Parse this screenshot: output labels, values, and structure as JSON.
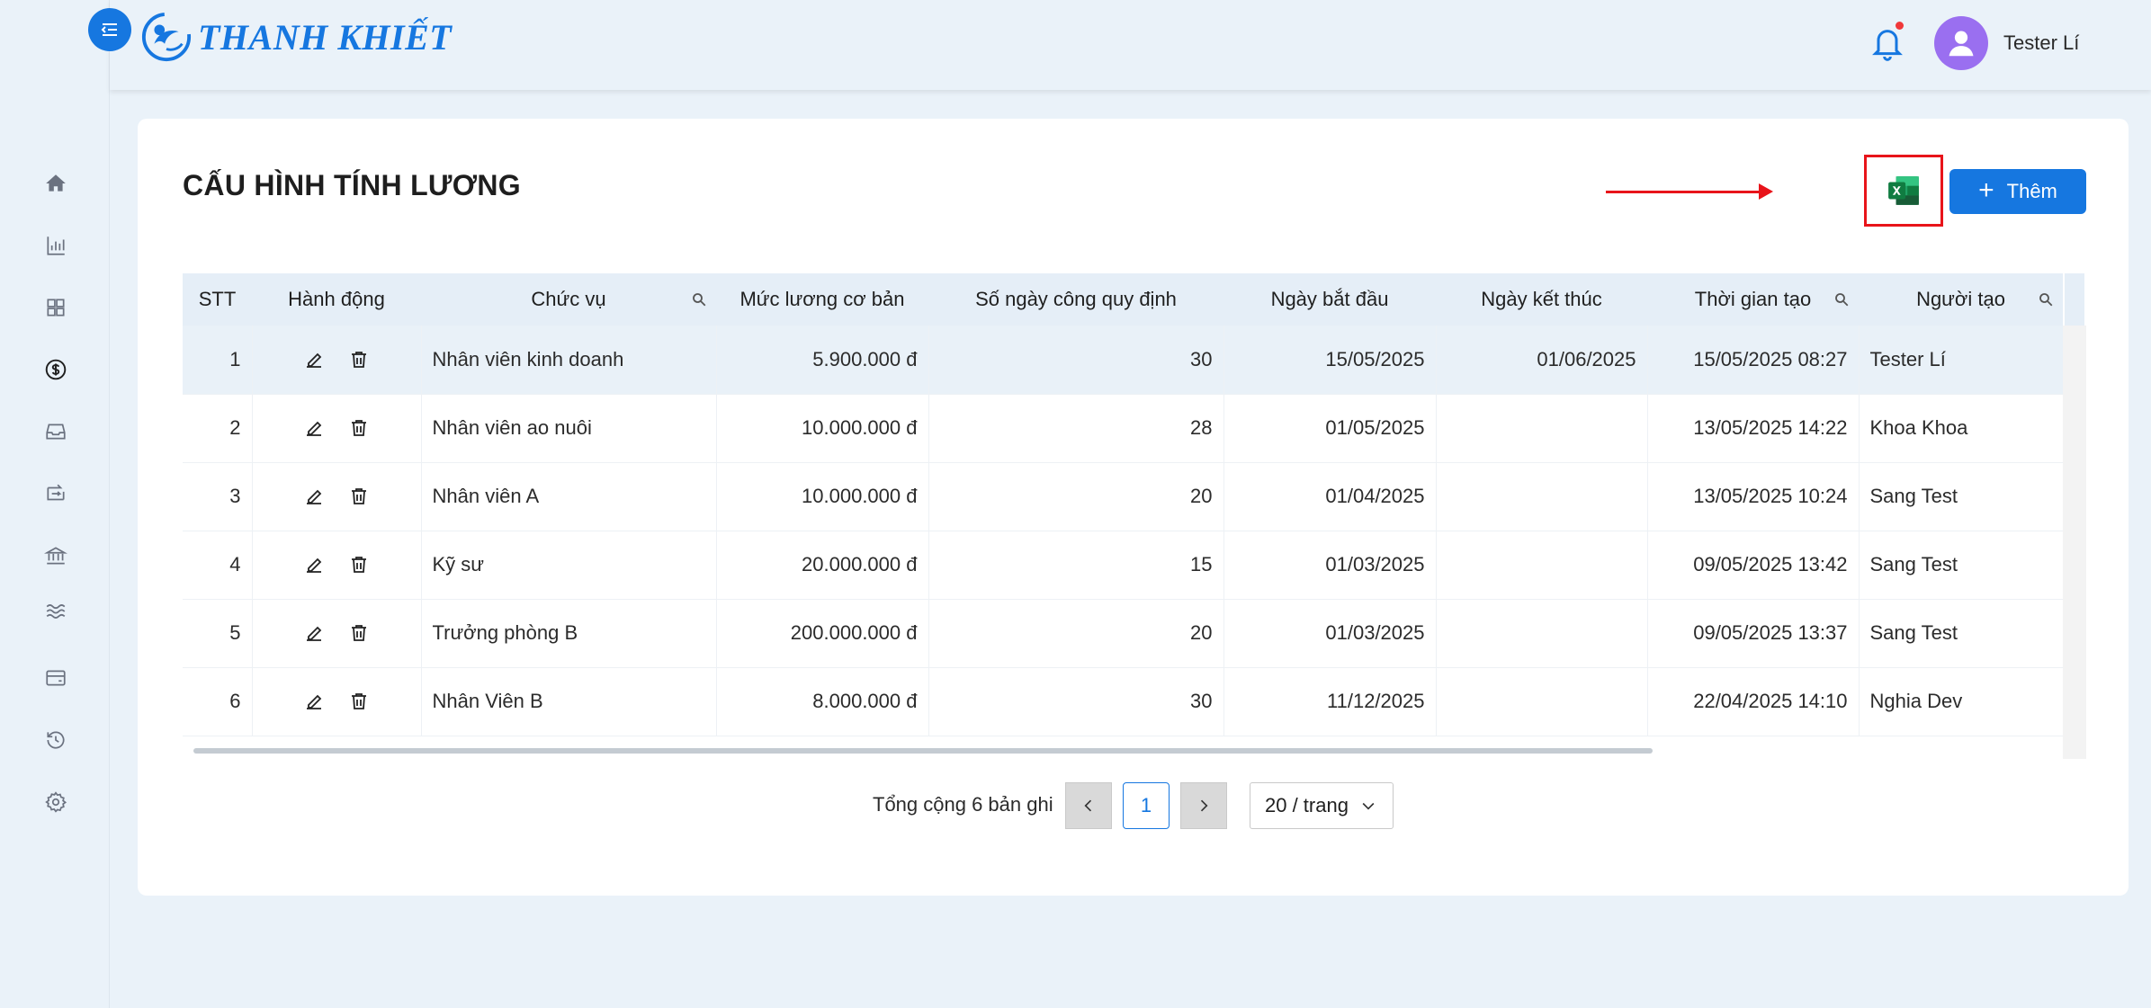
{
  "app": {
    "brand": "THANH KHIẾT",
    "user_name": "Tester Lí"
  },
  "sidebar": {
    "items": [
      {
        "icon": "home-icon"
      },
      {
        "icon": "bar-chart-icon"
      },
      {
        "icon": "grid-icon"
      },
      {
        "icon": "dollar-icon"
      },
      {
        "icon": "inbox-icon"
      },
      {
        "icon": "transfer-icon"
      },
      {
        "icon": "bank-icon"
      },
      {
        "icon": "waves-icon"
      },
      {
        "icon": "wallet-icon"
      },
      {
        "icon": "history-icon"
      },
      {
        "icon": "settings-icon"
      }
    ]
  },
  "page": {
    "title": "CẤU HÌNH TÍNH LƯƠNG",
    "add_label": "Thêm"
  },
  "table": {
    "headers": {
      "stt": "STT",
      "actions": "Hành động",
      "position": "Chức vụ",
      "salary": "Mức lương cơ bản",
      "days": "Số ngày công quy định",
      "start": "Ngày bắt đầu",
      "end": "Ngày kết thúc",
      "created": "Thời gian tạo",
      "creator": "Người tạo"
    },
    "rows": [
      {
        "stt": "1",
        "position": "Nhân viên kinh doanh",
        "salary": "5.900.000 đ",
        "days": "30",
        "start": "15/05/2025",
        "end": "01/06/2025",
        "created": "15/05/2025 08:27",
        "creator": "Tester Lí"
      },
      {
        "stt": "2",
        "position": "Nhân viên ao nuôi",
        "salary": "10.000.000 đ",
        "days": "28",
        "start": "01/05/2025",
        "end": "",
        "created": "13/05/2025 14:22",
        "creator": "Khoa Khoa"
      },
      {
        "stt": "3",
        "position": "Nhân viên A",
        "salary": "10.000.000 đ",
        "days": "20",
        "start": "01/04/2025",
        "end": "",
        "created": "13/05/2025 10:24",
        "creator": "Sang Test"
      },
      {
        "stt": "4",
        "position": "Kỹ sư",
        "salary": "20.000.000 đ",
        "days": "15",
        "start": "01/03/2025",
        "end": "",
        "created": "09/05/2025 13:42",
        "creator": "Sang Test"
      },
      {
        "stt": "5",
        "position": "Trưởng phòng B",
        "salary": "200.000.000 đ",
        "days": "20",
        "start": "01/03/2025",
        "end": "",
        "created": "09/05/2025 13:37",
        "creator": "Sang Test"
      },
      {
        "stt": "6",
        "position": "Nhân Viên B",
        "salary": "8.000.000 đ",
        "days": "30",
        "start": "11/12/2025",
        "end": "",
        "created": "22/04/2025 14:10",
        "creator": "Nghia Dev"
      }
    ]
  },
  "pagination": {
    "total_text": "Tổng cộng 6 bản ghi",
    "current_page": "1",
    "page_size": "20 / trang"
  },
  "colors": {
    "primary": "#1677e0",
    "highlight_box": "#e8141a",
    "excel_green": "#1f7a45"
  }
}
